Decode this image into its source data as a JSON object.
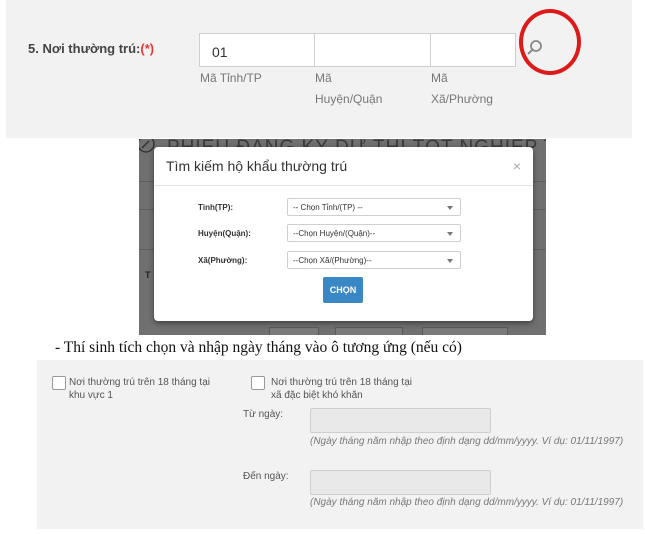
{
  "address": {
    "label": "5. Nơi thường trú:",
    "required_mark": "(*)",
    "province_code": "01",
    "province_label": "Mã Tỉnh/TP",
    "district_label": "Mã Huyện/Quận",
    "ward_label": "Mã Xã/Phường"
  },
  "modal": {
    "background_title": "PHIẾU ĐĂNG KÝ DỰ THI TỐT NGHIỆP THPT",
    "title": "Tìm kiếm hộ khẩu thường trú",
    "close": "×",
    "fields": [
      {
        "label": "Tỉnh(TP):",
        "value": "-- Chọn Tỉnh/(TP) --"
      },
      {
        "label": "Huyện(Quận):",
        "value": "--Chọn Huyện/(Quận)--"
      },
      {
        "label": "Xã(Phường):",
        "value": "--Chọn Xã/(Phường)--"
      }
    ],
    "button": "CHỌN"
  },
  "instruction": "- Thí sinh tích chọn và nhập ngày tháng vào ô tương ứng (nếu có)",
  "residence": {
    "option1": "Nơi thường trú trên 18 tháng tại khu vực 1",
    "option2": "Nơi thường trú trên 18 tháng tại xã đặc biệt khó khăn",
    "from_label": "Từ ngày:",
    "to_label": "Đến ngày:",
    "hint": "(Ngày tháng năm nhập theo định dạng dd/mm/yyyy. Ví dụ: 01/11/1997)"
  }
}
